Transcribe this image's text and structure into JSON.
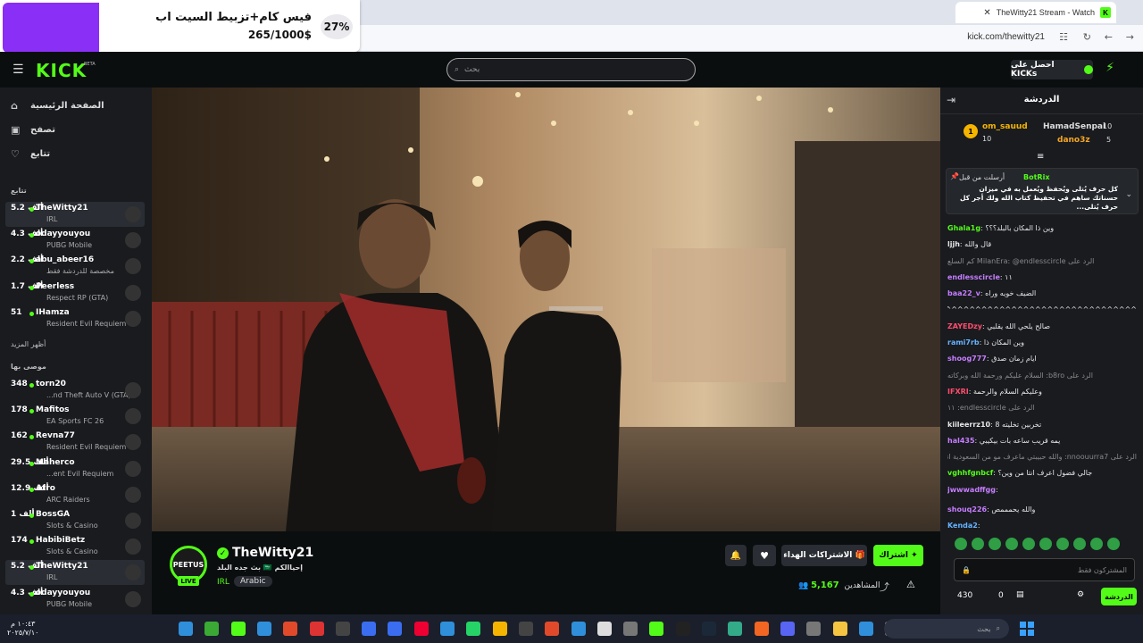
{
  "browser": {
    "tab_title": "TheWitty21 Stream - Watch",
    "url": "kick.com/thewitty21"
  },
  "donation": {
    "title": "فيس كام+تزبيط السيت اب",
    "amount": "265/1000$",
    "percent": "27%",
    "progress_fraction": 0.27
  },
  "header": {
    "logo": "KICK",
    "logo_badge": "BETA",
    "search_placeholder": "بحث",
    "get_kicks": "احصل على KICKs"
  },
  "sidebar": {
    "nav": [
      {
        "label": "الصفحة الرئيسية",
        "icon": "home-icon"
      },
      {
        "label": "تصفح",
        "icon": "browse-icon"
      },
      {
        "label": "تتابع",
        "icon": "heart-icon"
      }
    ],
    "following_header": "تتابع",
    "following": [
      {
        "name": "TheWitty21",
        "game": "IRL",
        "count": "5.2 ألف",
        "active": true
      },
      {
        "name": "odayyouyou",
        "game": "PUBG Mobile",
        "count": "4.3 ألف"
      },
      {
        "name": "abu_abeer16",
        "game": "مخصصة للدردشة فقط",
        "count": "2.2 ألف"
      },
      {
        "name": "Peerless",
        "game": "Respect RP (GTA)",
        "count": "1.7 ألف"
      },
      {
        "name": "IHamza",
        "game": "Resident Evil Requiem",
        "count": "51"
      }
    ],
    "show_more": "أظهر المزيد",
    "recommended_header": "موصى بها",
    "recommended": [
      {
        "name": "torn20",
        "game": "...nd Theft Auto V (GTA)",
        "count": "348"
      },
      {
        "name": "Mafitos",
        "game": "EA Sports FC 26",
        "count": "178"
      },
      {
        "name": "Revna77",
        "game": "Resident Evil Requiem",
        "count": "162"
      },
      {
        "name": "Maherco",
        "game": "...ent Evil Requiem",
        "count": "29.5 ألف"
      },
      {
        "name": "Atro",
        "game": "ARC Raiders",
        "count": "12.9 ألف"
      },
      {
        "name": "BossGA",
        "game": "Slots & Casino",
        "count": "1 ألف"
      },
      {
        "name": "HabibiBetz",
        "game": "Slots & Casino",
        "count": "174"
      },
      {
        "name": "TheWitty21",
        "game": "IRL",
        "count": "5.2 ألف",
        "active": true
      },
      {
        "name": "odayyouyou",
        "game": "PUBG Mobile",
        "count": "4.3 ألف"
      }
    ]
  },
  "stream": {
    "streamer": "TheWitty21",
    "avatar_text": "PEETUS",
    "live": "LIVE",
    "title": "بث جده البلد 🇸🇦 إحياالكم",
    "category": "IRL",
    "tag": "Arabic",
    "subscribe": "اشتراك",
    "gift_subs": "الاشتراكات الهداء",
    "viewers_label": "المشاهدين",
    "viewers": "5,167"
  },
  "chat": {
    "title": "الدردشة",
    "gifters": [
      {
        "name": "om_sauud",
        "count": "10"
      },
      {
        "name": "HamadSenpai",
        "count": "10"
      },
      {
        "name": "dano3z",
        "count": "5"
      }
    ],
    "pinned": {
      "user": "BotRix",
      "prefix": "أرسلت من قبل",
      "text": "كل حرف يُتلى ويُحفظ ويُعمل به في ميزان حسناتك ساهم في تحفيظ كتاب الله ولك أجر كل حرف يُتلى..."
    },
    "messages": [
      {
        "user": "Ghala1g",
        "text": "وين ذا المكان بالبلد؟؟؟",
        "color": "#53fc18"
      },
      {
        "user": "ljjh",
        "text": "قال والله",
        "color": "#e6e6e6"
      },
      {
        "user": "",
        "text": "الرد على MilanEra: @endlesscircle كم السلع",
        "color": "#888"
      },
      {
        "user": "endlesscircle",
        "text": "١١",
        "color": "#c77dff"
      },
      {
        "user": "baa22_v",
        "text": "الضيف خويه وراه",
        "color": "#c77dff"
      },
      {
        "user": "",
        "text": "^^^^^^^^^^^^^^^^^^^^^^^^^^^^^^^^^^^",
        "color": "#e6e6e6"
      },
      {
        "user": "ZAYEDzy",
        "text": "صالح يلحي الله يقلبي",
        "color": "#ff4d6d"
      },
      {
        "user": "rami7rb",
        "text": "وين المكان ذا",
        "color": "#66b3ff"
      },
      {
        "user": "shoog777",
        "text": "ايام زمان صدق",
        "color": "#c77dff"
      },
      {
        "user": "",
        "text": "الرد على b8ro: السلام عليكم ورحمة الله وبركاته",
        "color": "#888"
      },
      {
        "user": "IFXRI",
        "text": "وعليكم السلام والرحمة",
        "color": "#ff4d6d"
      },
      {
        "user": "",
        "text": "الرد على endlesscircle: ١١",
        "color": "#888"
      },
      {
        "user": "kiileerrz10",
        "text": "تخربين تخليته 8",
        "color": "#e6e6e6"
      },
      {
        "user": "hal435",
        "text": "يمه قريب ساعه بات بيكيبي",
        "color": "#c77dff"
      },
      {
        "user": "",
        "text": "الرد على nnoouurra7: والله حبيبتي ماعرف مو من السعودية اني",
        "color": "#888"
      },
      {
        "user": "vghhfgnbcf",
        "text": "جالي فضول اعرف انتا من وين؟",
        "color": "#53fc18"
      },
      {
        "user": "jwwwadffgg",
        "text": "",
        "color": "#c77dff"
      },
      {
        "user": "shouq226",
        "text": "والله يحمممص",
        "color": "#c77dff"
      },
      {
        "user": "Kenda2",
        "text": "",
        "color": "#66b3ff"
      }
    ],
    "input_placeholder": "المشتركون فقط",
    "kicks_balance": "430",
    "points": "0",
    "send": "الدردشة"
  },
  "taskbar": {
    "search": "بحث",
    "time": "١٠:٤٣ م",
    "date": "٢٠٢٥/٧/١٠"
  },
  "colors": {
    "kick_green": "#53fc18",
    "background": "#0b0e0f",
    "panel": "#191b1f"
  }
}
